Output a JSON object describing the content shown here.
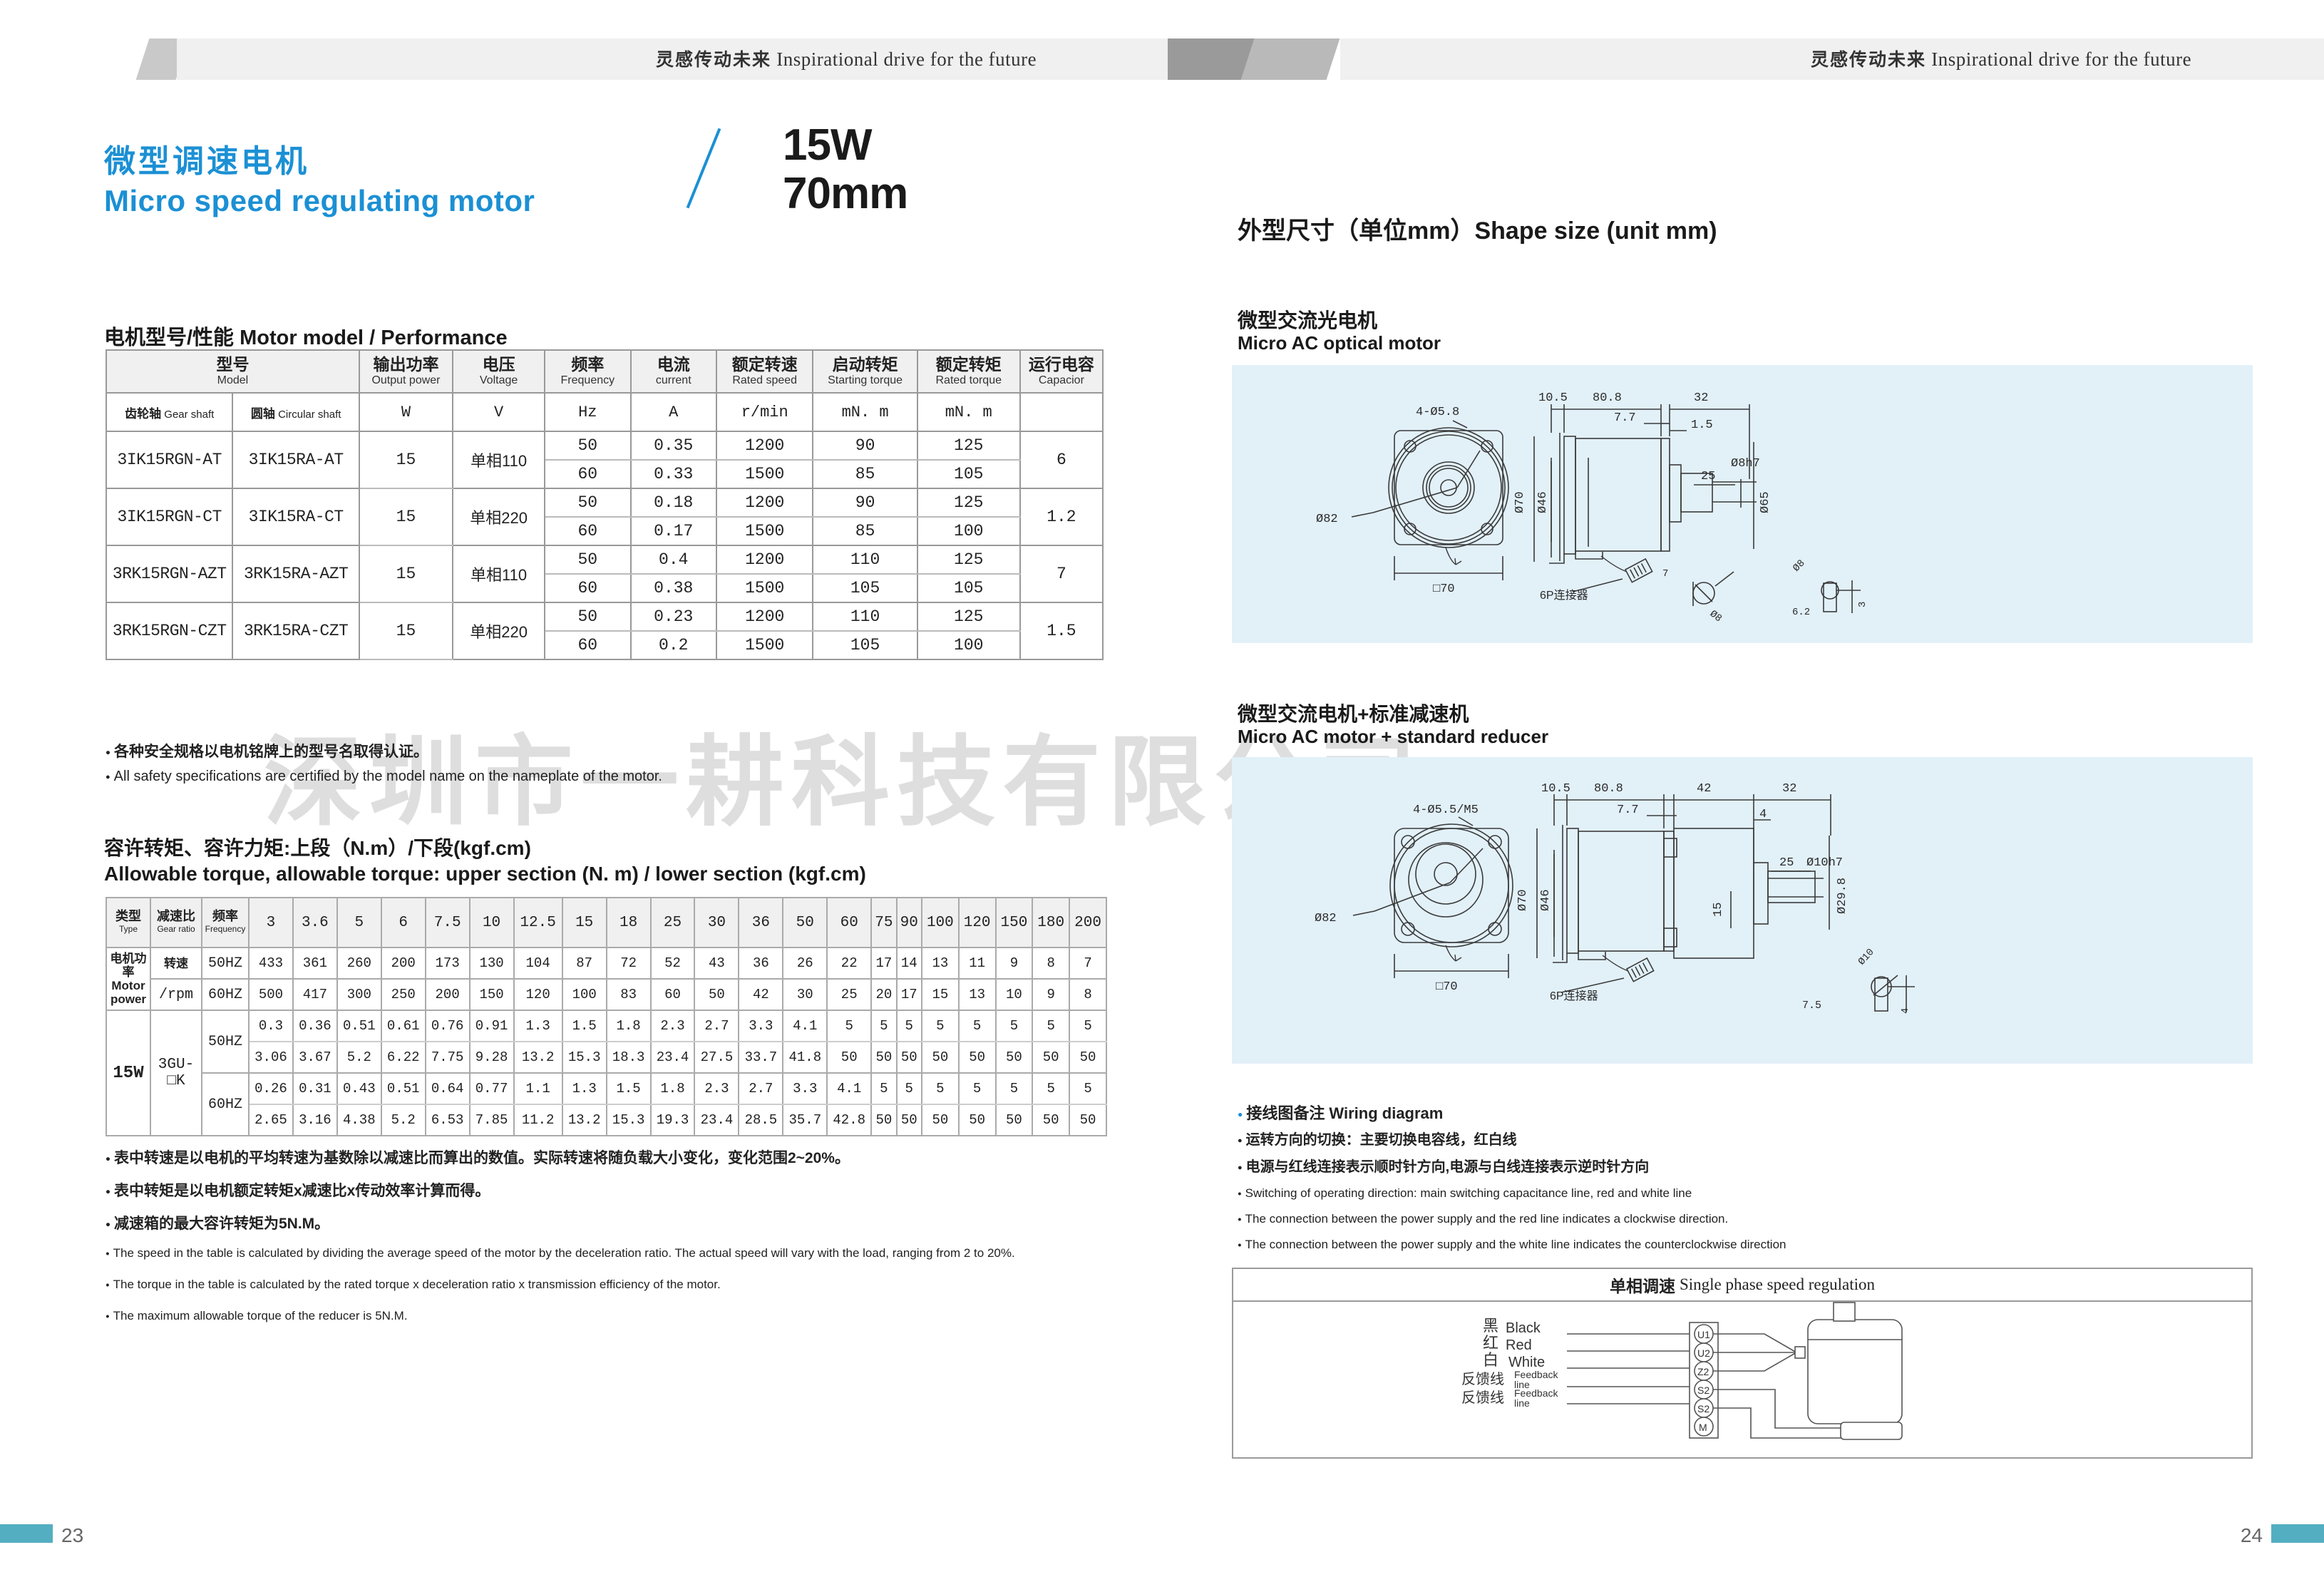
{
  "header": {
    "brand_cn": "灵感传动未来",
    "brand_en": "Inspirational drive for the future"
  },
  "title": {
    "cn": "微型调速电机",
    "en": "Micro speed regulating motor",
    "power": "15W",
    "size": "70mm"
  },
  "motor_model_heading": "电机型号/性能 Motor model / Performance",
  "performance_table": {
    "headers": [
      {
        "cn": "型号",
        "en": "Model"
      },
      {
        "cn": "输出功率",
        "en": "Output power"
      },
      {
        "cn": "电压",
        "en": "Voltage"
      },
      {
        "cn": "频率",
        "en": "Frequency"
      },
      {
        "cn": "电流",
        "en": "current"
      },
      {
        "cn": "额定转速",
        "en": "Rated speed"
      },
      {
        "cn": "启动转矩",
        "en": "Starting torque"
      },
      {
        "cn": "额定转矩",
        "en": "Rated torque"
      },
      {
        "cn": "运行电容",
        "en": "Capacior"
      }
    ],
    "subheaders": {
      "gear_shaft_cn": "齿轮轴",
      "gear_shaft_en": "Gear shaft",
      "circular_shaft_cn": "圆轴",
      "circular_shaft_en": "Circular shaft"
    },
    "units": [
      "W",
      "V",
      "Hz",
      "A",
      "r/min",
      "mN. m",
      "mN. m"
    ],
    "rows": [
      {
        "gear": "3IK15RGN-AT",
        "circ": "3IK15RA-AT",
        "power": "15",
        "voltage": "单相110",
        "capacitor": "6",
        "lines": [
          {
            "freq": "50",
            "current": "0.35",
            "speed": "1200",
            "start": "90",
            "rated": "125"
          },
          {
            "freq": "60",
            "current": "0.33",
            "speed": "1500",
            "start": "85",
            "rated": "105"
          }
        ]
      },
      {
        "gear": "3IK15RGN-CT",
        "circ": "3IK15RA-CT",
        "power": "15",
        "voltage": "单相220",
        "capacitor": "1.2",
        "lines": [
          {
            "freq": "50",
            "current": "0.18",
            "speed": "1200",
            "start": "90",
            "rated": "125"
          },
          {
            "freq": "60",
            "current": "0.17",
            "speed": "1500",
            "start": "85",
            "rated": "100"
          }
        ]
      },
      {
        "gear": "3RK15RGN-AZT",
        "circ": "3RK15RA-AZT",
        "power": "15",
        "voltage": "单相110",
        "capacitor": "7",
        "lines": [
          {
            "freq": "50",
            "current": "0.4",
            "speed": "1200",
            "start": "110",
            "rated": "125"
          },
          {
            "freq": "60",
            "current": "0.38",
            "speed": "1500",
            "start": "105",
            "rated": "105"
          }
        ]
      },
      {
        "gear": "3RK15RGN-CZT",
        "circ": "3RK15RA-CZT",
        "power": "15",
        "voltage": "单相220",
        "capacitor": "1.5",
        "lines": [
          {
            "freq": "50",
            "current": "0.23",
            "speed": "1200",
            "start": "110",
            "rated": "125"
          },
          {
            "freq": "60",
            "current": "0.2",
            "speed": "1500",
            "start": "105",
            "rated": "100"
          }
        ]
      }
    ]
  },
  "safety_notes": {
    "cn": "各种安全规格以电机铭牌上的型号名取得认证。",
    "en": "All safety specifications are certified by the model name on the nameplate of the motor."
  },
  "torque_heading": {
    "cn": "容许转矩、容许力矩:上段（N.m）/下段(kgf.cm)",
    "en": "Allowable torque, allowable torque: upper section (N. m) / lower section (kgf.cm)"
  },
  "torque_table": {
    "corner_headers": [
      {
        "cn": "类型",
        "en": "Type"
      },
      {
        "cn": "减速比",
        "en": "Gear ratio"
      },
      {
        "cn": "频率",
        "en": "Frequency"
      }
    ],
    "ratios": [
      "3",
      "3.6",
      "5",
      "6",
      "7.5",
      "10",
      "12.5",
      "15",
      "18",
      "25",
      "30",
      "36",
      "50",
      "60",
      "75",
      "90",
      "100",
      "120",
      "150",
      "180",
      "200"
    ],
    "motor_power_label": {
      "cn": "电机功率",
      "en": "Motor power"
    },
    "speed_label_cn": "转速",
    "speed_label_unit": "/rpm",
    "type_value": "15W",
    "gear_ratio_value": "3GU-□K",
    "speed_rows": [
      {
        "freq": "50HZ",
        "values": [
          "433",
          "361",
          "260",
          "200",
          "173",
          "130",
          "104",
          "87",
          "72",
          "52",
          "43",
          "36",
          "26",
          "22",
          "17",
          "14",
          "13",
          "11",
          "9",
          "8",
          "7"
        ]
      },
      {
        "freq": "60HZ",
        "values": [
          "500",
          "417",
          "300",
          "250",
          "200",
          "150",
          "120",
          "100",
          "83",
          "60",
          "50",
          "42",
          "30",
          "25",
          "20",
          "17",
          "15",
          "13",
          "10",
          "9",
          "8"
        ]
      }
    ],
    "torque_rows": [
      {
        "freq": "50HZ",
        "upper": [
          "0.3",
          "0.36",
          "0.51",
          "0.61",
          "0.76",
          "0.91",
          "1.3",
          "1.5",
          "1.8",
          "2.3",
          "2.7",
          "3.3",
          "4.1",
          "5",
          "5",
          "5",
          "5",
          "5",
          "5",
          "5",
          "5"
        ],
        "lower": [
          "3.06",
          "3.67",
          "5.2",
          "6.22",
          "7.75",
          "9.28",
          "13.2",
          "15.3",
          "18.3",
          "23.4",
          "27.5",
          "33.7",
          "41.8",
          "50",
          "50",
          "50",
          "50",
          "50",
          "50",
          "50",
          "50"
        ]
      },
      {
        "freq": "60HZ",
        "upper": [
          "0.26",
          "0.31",
          "0.43",
          "0.51",
          "0.64",
          "0.77",
          "1.1",
          "1.3",
          "1.5",
          "1.8",
          "2.3",
          "2.7",
          "3.3",
          "4.1",
          "5",
          "5",
          "5",
          "5",
          "5",
          "5",
          "5"
        ],
        "lower": [
          "2.65",
          "3.16",
          "4.38",
          "5.2",
          "6.53",
          "7.85",
          "11.2",
          "13.2",
          "15.3",
          "19.3",
          "23.4",
          "28.5",
          "35.7",
          "42.8",
          "50",
          "50",
          "50",
          "50",
          "50",
          "50",
          "50"
        ]
      }
    ]
  },
  "table_notes": {
    "cn1": "表中转速是以电机的平均转速为基数除以减速比而算出的数值。实际转速将随负载大小变化，变化范围2~20%。",
    "cn2": "表中转矩是以电机额定转矩x减速比x传动效率计算而得。",
    "cn3": "减速箱的最大容许转矩为5N.M。",
    "en1": "The speed in the table is calculated by dividing the average speed of the motor by the deceleration ratio. The actual speed will vary with the load, ranging from 2 to 20%.",
    "en2": "The torque in the table is calculated by the rated torque x deceleration ratio x transmission efficiency of the motor.",
    "en3": "The maximum allowable torque of the reducer is 5N.M."
  },
  "watermark": "深圳市一耕科技有限公司",
  "shape_size_heading": "外型尺寸（单位mm）Shape size (unit mm)",
  "drawing1": {
    "cn": "微型交流光电机",
    "en": "Micro AC optical motor",
    "dims": {
      "holes": "4-Ø5.8",
      "bolt_circle": "Ø82",
      "square": "□70",
      "d70": "Ø70",
      "d46": "Ø46",
      "d65": "Ø65",
      "len_10_5": "10.5",
      "len_80_8": "80.8",
      "len_32": "32",
      "len_7_7": "7.7",
      "len_1_5": "1.5",
      "len_25": "25",
      "shaft": "Ø8h7",
      "connector": "6P连接器",
      "key_7": "7",
      "key_d8": "Ø8",
      "key_6_2": "6.2",
      "key_3": "3"
    }
  },
  "drawing2": {
    "cn": "微型交流电机+标准减速机",
    "en": "Micro AC motor + standard reducer",
    "dims": {
      "holes": "4-Ø5.5/M5",
      "bolt_circle": "Ø82",
      "square": "□70",
      "d70": "Ø70",
      "d46": "Ø46",
      "d29_8": "Ø29.8",
      "len_10_5": "10.5",
      "len_80_8": "80.8",
      "len_42": "42",
      "len_32": "32",
      "len_7_7": "7.7",
      "len_4": "4",
      "len_15": "15",
      "len_25": "25",
      "shaft": "Ø10h7",
      "connector": "6P连接器",
      "key_7_5": "7.5",
      "key_d10": "Ø10",
      "key_4": "4"
    }
  },
  "wiring_notes": {
    "title": "接线图备注 Wiring diagram",
    "cn1": "运转方向的切换：主要切换电容线，红白线",
    "cn2": "电源与红线连接表示顺时针方向,电源与白线连接表示逆时针方向",
    "en1": "Switching of operating direction: main switching capacitance line, red and white line",
    "en2": "The connection between the power supply and the red line indicates a clockwise direction.",
    "en3": "The connection between the power supply and the white line indicates the counterclockwise direction"
  },
  "wiring_box": {
    "title_cn": "单相调速",
    "title_en": "Single phase speed regulation",
    "leads": [
      {
        "cn": "黑",
        "en": "Black",
        "terminal": "U1"
      },
      {
        "cn": "红",
        "en": "Red",
        "terminal": "U2"
      },
      {
        "cn": "白",
        "en": "White",
        "terminal": "Z2"
      },
      {
        "cn": "反馈线",
        "en": "Feedback line",
        "terminal": "S2"
      },
      {
        "cn": "反馈线",
        "en": "Feedback line",
        "terminal": "S2"
      },
      {
        "cn": "",
        "en": "",
        "terminal": "M"
      }
    ]
  },
  "footer": {
    "page_left": "23",
    "page_right": "24"
  },
  "colors": {
    "brand_blue": "#1b90d4",
    "drawing_bg": "#e2f0f8",
    "footer_bar": "#53aec2"
  }
}
